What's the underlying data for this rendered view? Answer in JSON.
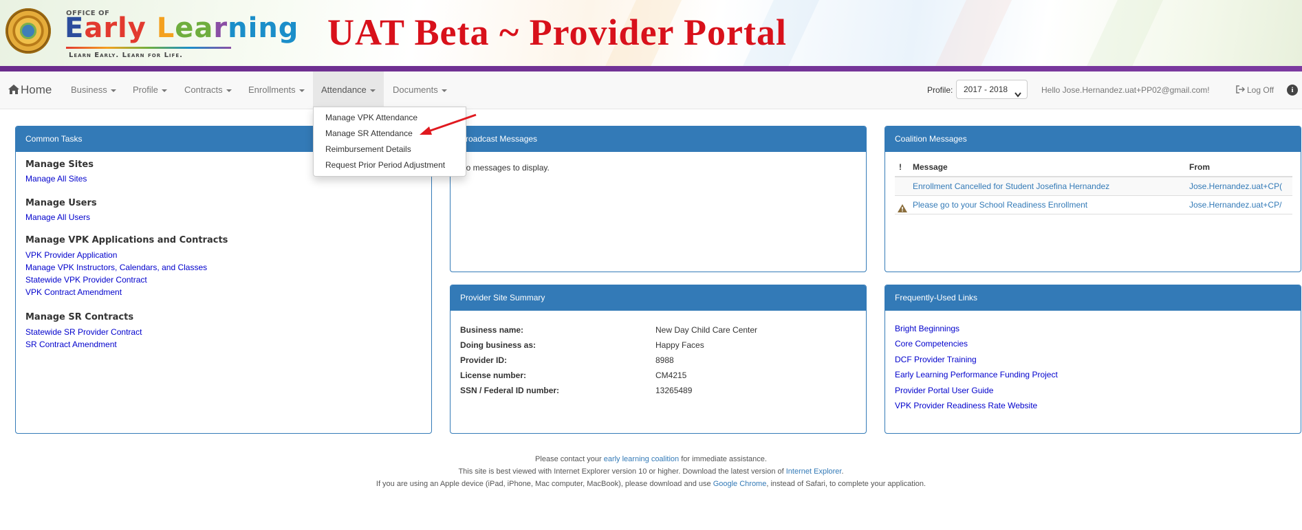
{
  "header": {
    "logo_top": "OFFICE OF",
    "logo_main": [
      "E",
      "arly ",
      "L",
      "ea",
      "r",
      "ning"
    ],
    "logo_tagline": "Learn Early. Learn for Life.",
    "title": "UAT Beta ~ Provider Portal"
  },
  "nav": {
    "home": "Home",
    "items": [
      {
        "label": "Business"
      },
      {
        "label": "Profile"
      },
      {
        "label": "Contracts"
      },
      {
        "label": "Enrollments"
      },
      {
        "label": "Attendance"
      },
      {
        "label": "Documents"
      }
    ],
    "profile_label": "Profile:",
    "profile_value": "2017 - 2018",
    "hello": "Hello Jose.Hernandez.uat+PP02@gmail.com!",
    "logoff": "Log Off"
  },
  "attendance_menu": [
    "Manage VPK Attendance",
    "Manage SR Attendance",
    "Reimbursement Details",
    "Request Prior Period Adjustment"
  ],
  "common_tasks": {
    "title": "Common Tasks",
    "sections": [
      {
        "title": "Manage Sites",
        "links": [
          "Manage All Sites"
        ]
      },
      {
        "title": "Manage Users",
        "links": [
          "Manage All Users"
        ]
      },
      {
        "title": "Manage VPK Applications and Contracts",
        "links": [
          "VPK Provider Application",
          "Manage VPK Instructors, Calendars, and Classes",
          "Statewide VPK Provider Contract",
          "VPK Contract Amendment"
        ]
      },
      {
        "title": "Manage SR Contracts",
        "links": [
          "Statewide SR Provider Contract",
          "SR Contract Amendment"
        ]
      }
    ]
  },
  "broadcast": {
    "title": "Broadcast Messages",
    "empty": "No messages to display."
  },
  "coalition": {
    "title": "Coalition Messages",
    "col_flag": "!",
    "col_message": "Message",
    "col_from": "From",
    "rows": [
      {
        "flag": "",
        "message": "Enrollment Cancelled for Student Josefina Hernandez",
        "from": "Jose.Hernandez.uat+CP("
      },
      {
        "flag": "warning",
        "message": "Please go to your School Readiness Enrollment",
        "from": "Jose.Hernandez.uat+CP/"
      }
    ]
  },
  "summary": {
    "title": "Provider Site Summary",
    "rows": [
      {
        "label": "Business name:",
        "value": "New Day Child Care Center"
      },
      {
        "label": "Doing business as:",
        "value": "Happy Faces"
      },
      {
        "label": "Provider ID:",
        "value": "8988"
      },
      {
        "label": "License number:",
        "value": "CM4215"
      },
      {
        "label": "SSN / Federal ID number:",
        "value": "13265489"
      }
    ]
  },
  "links": {
    "title": "Frequently-Used Links",
    "items": [
      "Bright Beginnings",
      "Core Competencies",
      "DCF Provider Training",
      "Early Learning Performance Funding Project",
      "Provider Portal User Guide",
      "VPK Provider Readiness Rate Website"
    ]
  },
  "footer": {
    "l1a": "Please contact your ",
    "l1link": "early learning coalition",
    "l1b": " for immediate assistance.",
    "l2a": "This site is best viewed with Internet Explorer version 10 or higher. Download the latest version of ",
    "l2link": "Internet Explorer",
    "l2b": ".",
    "l3a": "If you are using an Apple device (iPad, iPhone, Mac computer, MacBook), please download and use ",
    "l3link": "Google Chrome",
    "l3b": ", instead of Safari, to complete your application."
  }
}
